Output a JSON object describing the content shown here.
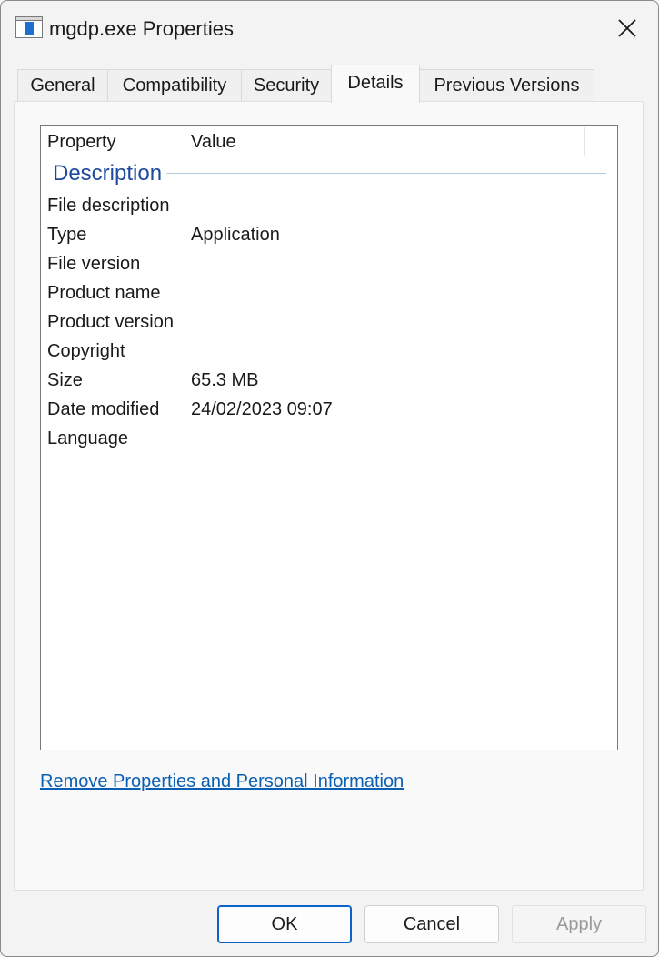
{
  "window": {
    "title": "mgdp.exe Properties",
    "icon": "application-icon"
  },
  "tabs": [
    {
      "label": "General",
      "active": false
    },
    {
      "label": "Compatibility",
      "active": false
    },
    {
      "label": "Security",
      "active": false
    },
    {
      "label": "Details",
      "active": true
    },
    {
      "label": "Previous Versions",
      "active": false
    }
  ],
  "details": {
    "columns": {
      "property": "Property",
      "value": "Value"
    },
    "group": "Description",
    "rows": [
      {
        "property": "File description",
        "value": ""
      },
      {
        "property": "Type",
        "value": "Application"
      },
      {
        "property": "File version",
        "value": ""
      },
      {
        "property": "Product name",
        "value": ""
      },
      {
        "property": "Product version",
        "value": ""
      },
      {
        "property": "Copyright",
        "value": ""
      },
      {
        "property": "Size",
        "value": "65.3 MB"
      },
      {
        "property": "Date modified",
        "value": "24/02/2023 09:07"
      },
      {
        "property": "Language",
        "value": ""
      }
    ]
  },
  "link": {
    "label": "Remove Properties and Personal Information"
  },
  "buttons": {
    "ok": "OK",
    "cancel": "Cancel",
    "apply": "Apply"
  },
  "colors": {
    "accent": "#0a63c8",
    "group_title": "#1e4a9e",
    "link": "#0a5fb4"
  }
}
